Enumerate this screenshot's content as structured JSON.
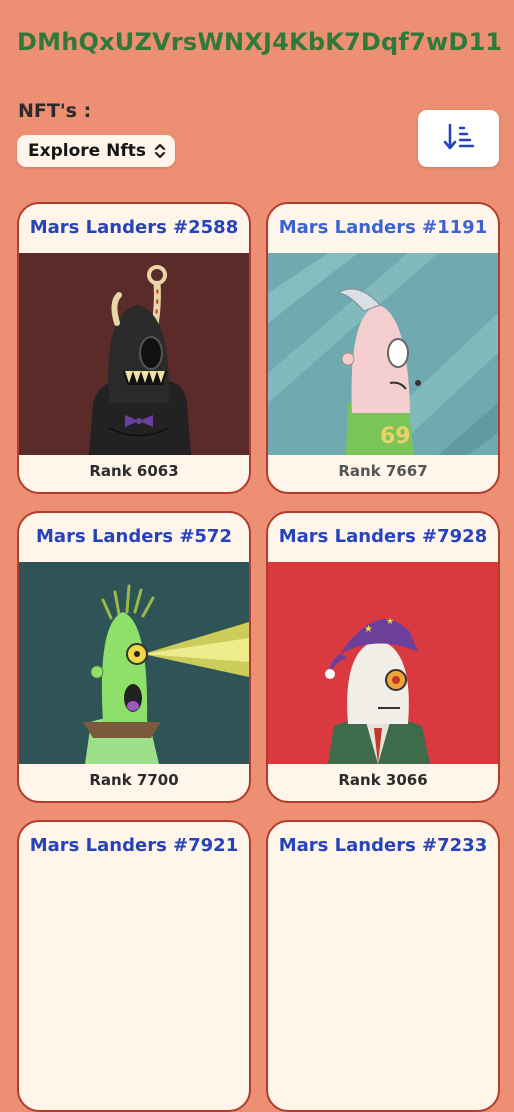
{
  "header": {
    "wallet_address": "DMhQxUZVrsWNXJ4KbK7Dqf7wD11",
    "nfts_label": "NFT's :",
    "dropdown_selected": "Explore Nfts"
  },
  "icons": {
    "sort": "sort-descending-icon",
    "dropdown": "chevron-up-down-icon"
  },
  "colors": {
    "background": "#ec8f73",
    "wallet_text": "#2f7a3a",
    "card_title": "#2743b9",
    "card_border": "#b13d2c",
    "card_bg": "#fff5ea"
  },
  "nfts": [
    {
      "name": "Mars Landers #2588",
      "rank": "Rank 6063",
      "art_background": "#5a2b28"
    },
    {
      "name": "Mars Landers #1191",
      "rank": "Rank 7667",
      "art_background": "#6faab0"
    },
    {
      "name": "Mars Landers #572",
      "rank": "Rank 7700",
      "art_background": "#2f5458"
    },
    {
      "name": "Mars Landers #7928",
      "rank": "Rank 3066",
      "art_background": "#d9393f"
    },
    {
      "name": "Mars Landers #7921",
      "rank": "",
      "art_background": ""
    },
    {
      "name": "Mars Landers #7233",
      "rank": "",
      "art_background": ""
    }
  ]
}
